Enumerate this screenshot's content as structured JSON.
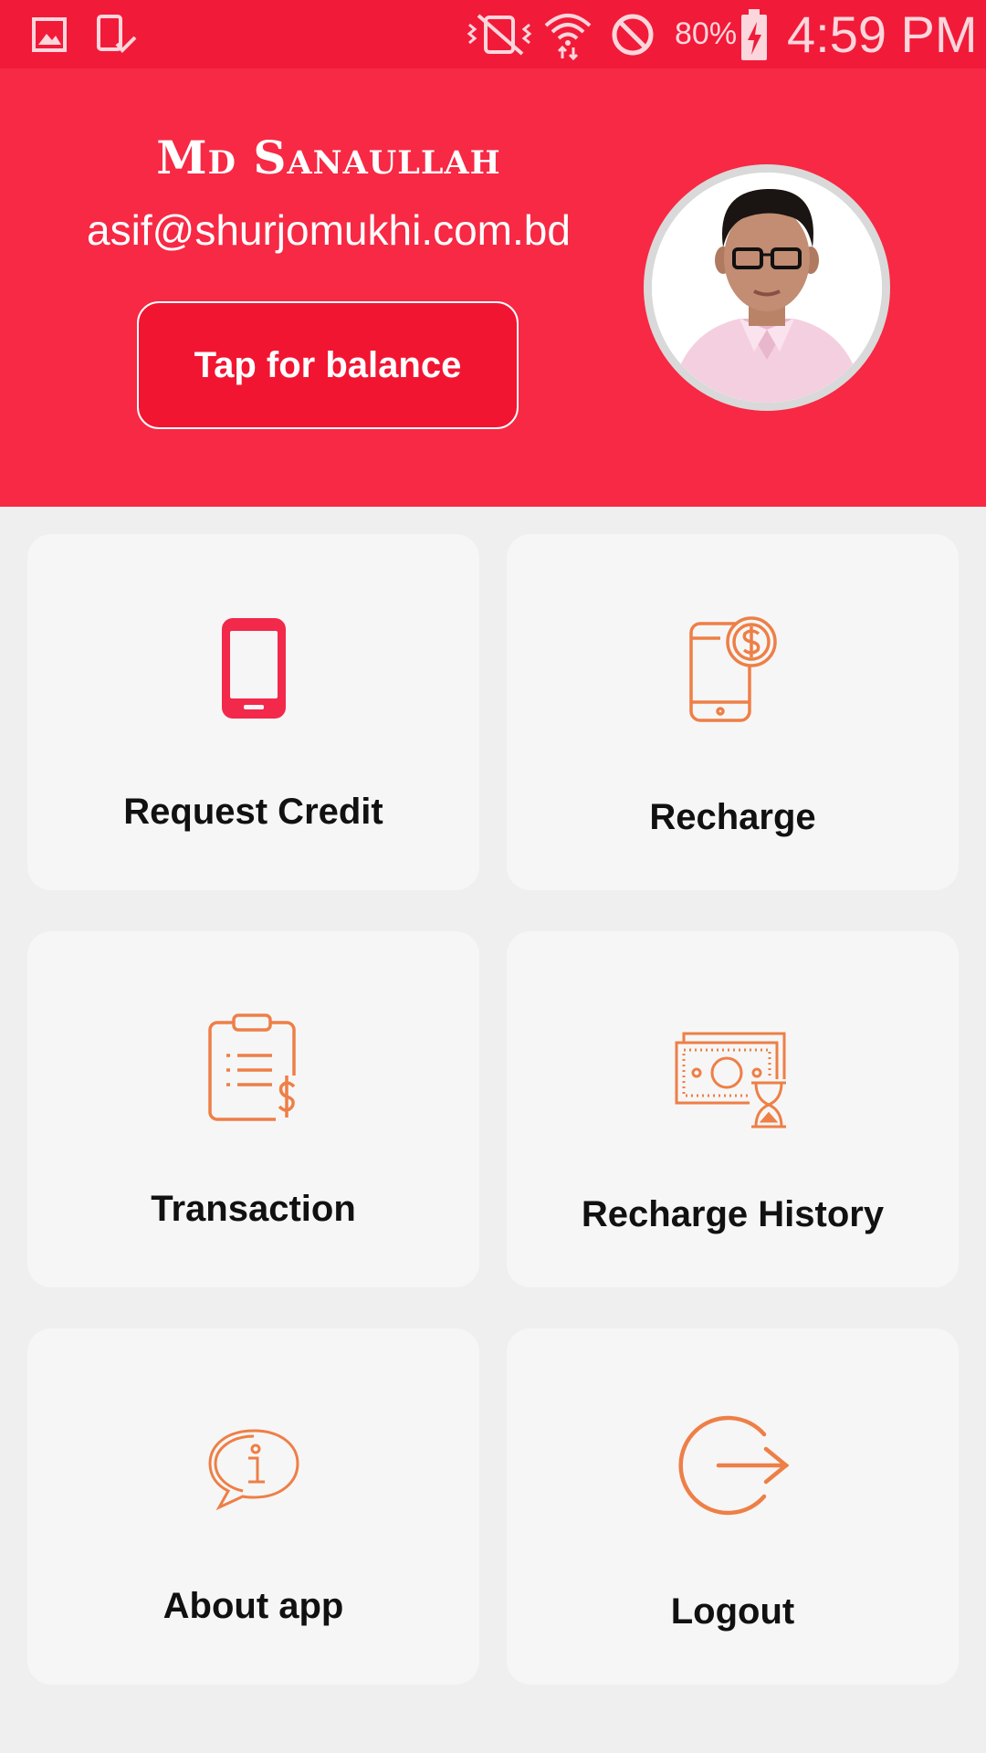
{
  "status_bar": {
    "battery": "80%",
    "time": "4:59 PM",
    "icons": [
      "gallery-icon",
      "phone-check-icon",
      "vibrate-mute-icon",
      "wifi-icon",
      "do-not-disturb-icon",
      "battery-charging-icon"
    ]
  },
  "profile": {
    "name": "Md Sanaullah",
    "email": "asif@shurjomukhi.com.bd",
    "balance_button": "Tap for balance"
  },
  "menu": [
    {
      "label": "Request Credit",
      "icon": "smartphone-icon"
    },
    {
      "label": "Recharge",
      "icon": "phone-dollar-icon"
    },
    {
      "label": "Transaction",
      "icon": "clipboard-dollar-icon"
    },
    {
      "label": "Recharge History",
      "icon": "cash-hourglass-icon"
    },
    {
      "label": "About app",
      "icon": "info-bubble-icon"
    },
    {
      "label": "Logout",
      "icon": "logout-icon"
    }
  ],
  "colors": {
    "status_bar": "#f21a39",
    "header": "#f72944",
    "accent_icon": "#f2294a",
    "orange_icon": "#ee7f46",
    "card_bg": "#f6f6f6",
    "page_bg": "#efefef"
  }
}
